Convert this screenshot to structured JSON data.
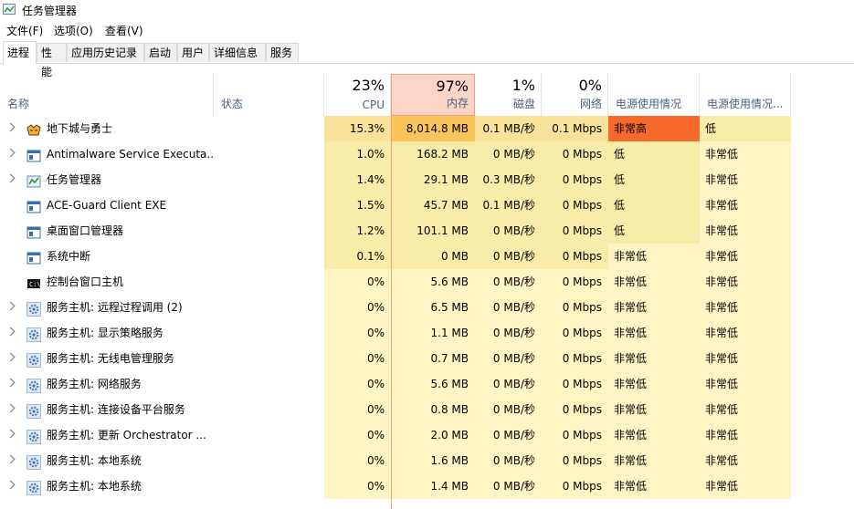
{
  "window": {
    "title": "任务管理器"
  },
  "menu": [
    "文件(F)",
    "选项(O)",
    "查看(V)"
  ],
  "tabs": [
    "进程",
    "性能",
    "应用历史记录",
    "启动",
    "用户",
    "详细信息",
    "服务"
  ],
  "columns": {
    "name": "名称",
    "status": "状态",
    "cpu": {
      "pct": "23%",
      "label": "CPU"
    },
    "memory": {
      "pct": "97%",
      "label": "内存"
    },
    "disk": {
      "pct": "1%",
      "label": "磁盘"
    },
    "network": {
      "pct": "0%",
      "label": "网络"
    },
    "power": "电源使用情况",
    "power_trend": "电源使用情况..."
  },
  "colors": {
    "heat_light": "#fff4c4",
    "heat_mid": "#f9eca8",
    "heat_strong": "#f9e39b",
    "mem_hot": "#fbc55b",
    "power_very_high": "#f6692a",
    "sorted_header": "#fbd5c7"
  },
  "processes": [
    {
      "name": "地下城与勇士",
      "icon": "game-icon",
      "expandable": true,
      "cpu": "15.3%",
      "mem": "8,014.8 MB",
      "disk": "0.1 MB/秒",
      "net": "0.1 Mbps",
      "power": "非常高",
      "trend": "低",
      "heat": "hot"
    },
    {
      "name": "Antimalware Service Executa...",
      "icon": "service-window-icon",
      "expandable": true,
      "cpu": "1.0%",
      "mem": "168.2 MB",
      "disk": "0 MB/秒",
      "net": "0 Mbps",
      "power": "低",
      "trend": "非常低",
      "heat": "mid"
    },
    {
      "name": "任务管理器",
      "icon": "task-manager-icon",
      "expandable": true,
      "cpu": "1.4%",
      "mem": "29.1 MB",
      "disk": "0.3 MB/秒",
      "net": "0 Mbps",
      "power": "低",
      "trend": "非常低",
      "heat": "mid"
    },
    {
      "name": "ACE-Guard Client EXE",
      "icon": "service-window-icon",
      "expandable": false,
      "cpu": "1.5%",
      "mem": "45.7 MB",
      "disk": "0.1 MB/秒",
      "net": "0 Mbps",
      "power": "低",
      "trend": "非常低",
      "heat": "mid"
    },
    {
      "name": "桌面窗口管理器",
      "icon": "service-window-icon",
      "expandable": false,
      "cpu": "1.2%",
      "mem": "101.1 MB",
      "disk": "0 MB/秒",
      "net": "0 Mbps",
      "power": "低",
      "trend": "非常低",
      "heat": "mid"
    },
    {
      "name": "系统中断",
      "icon": "service-window-icon",
      "expandable": false,
      "cpu": "0.1%",
      "mem": "0 MB",
      "disk": "0 MB/秒",
      "net": "0 Mbps",
      "power": "非常低",
      "trend": "非常低",
      "heat": "mid"
    },
    {
      "name": "控制台窗口主机",
      "icon": "console-icon",
      "expandable": false,
      "cpu": "0%",
      "mem": "5.6 MB",
      "disk": "0 MB/秒",
      "net": "0 Mbps",
      "power": "非常低",
      "trend": "非常低",
      "heat": "low"
    },
    {
      "name": "服务主机: 远程过程调用 (2)",
      "icon": "gear-icon",
      "expandable": true,
      "cpu": "0%",
      "mem": "6.5 MB",
      "disk": "0 MB/秒",
      "net": "0 Mbps",
      "power": "非常低",
      "trend": "非常低",
      "heat": "low"
    },
    {
      "name": "服务主机: 显示策略服务",
      "icon": "gear-icon",
      "expandable": true,
      "cpu": "0%",
      "mem": "1.1 MB",
      "disk": "0 MB/秒",
      "net": "0 Mbps",
      "power": "非常低",
      "trend": "非常低",
      "heat": "low"
    },
    {
      "name": "服务主机: 无线电管理服务",
      "icon": "gear-icon",
      "expandable": true,
      "cpu": "0%",
      "mem": "0.7 MB",
      "disk": "0 MB/秒",
      "net": "0 Mbps",
      "power": "非常低",
      "trend": "非常低",
      "heat": "low"
    },
    {
      "name": "服务主机: 网络服务",
      "icon": "gear-icon",
      "expandable": true,
      "cpu": "0%",
      "mem": "5.6 MB",
      "disk": "0 MB/秒",
      "net": "0 Mbps",
      "power": "非常低",
      "trend": "非常低",
      "heat": "low"
    },
    {
      "name": "服务主机: 连接设备平台服务",
      "icon": "gear-icon",
      "expandable": true,
      "cpu": "0%",
      "mem": "0.8 MB",
      "disk": "0 MB/秒",
      "net": "0 Mbps",
      "power": "非常低",
      "trend": "非常低",
      "heat": "low"
    },
    {
      "name": "服务主机: 更新 Orchestrator ...",
      "icon": "gear-icon",
      "expandable": true,
      "cpu": "0%",
      "mem": "2.0 MB",
      "disk": "0 MB/秒",
      "net": "0 Mbps",
      "power": "非常低",
      "trend": "非常低",
      "heat": "low"
    },
    {
      "name": "服务主机: 本地系统",
      "icon": "gear-icon",
      "expandable": true,
      "cpu": "0%",
      "mem": "1.6 MB",
      "disk": "0 MB/秒",
      "net": "0 Mbps",
      "power": "非常低",
      "trend": "非常低",
      "heat": "low"
    },
    {
      "name": "服务主机: 本地系统",
      "icon": "gear-icon",
      "expandable": true,
      "cpu": "0%",
      "mem": "1.4 MB",
      "disk": "0 MB/秒",
      "net": "0 Mbps",
      "power": "非常低",
      "trend": "非常低",
      "heat": "low"
    }
  ]
}
